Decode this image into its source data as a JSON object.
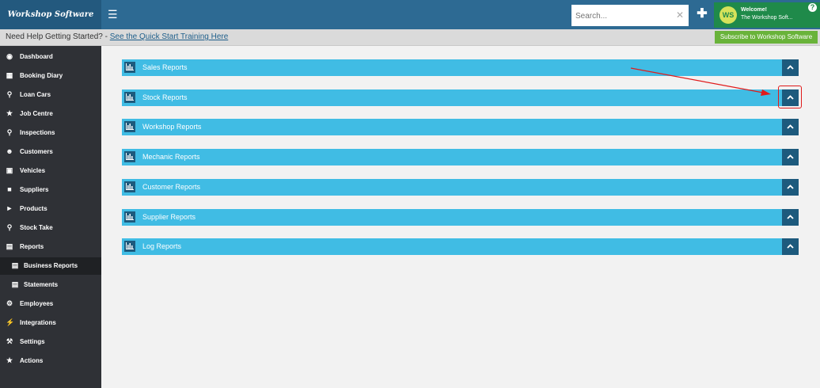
{
  "topbar": {
    "brand": "Workshop Software",
    "search": {
      "placeholder": "Search...",
      "value": ""
    },
    "user": {
      "welcome": "Welcome!",
      "name": "The Workshop Soft..."
    }
  },
  "infobar": {
    "help_prefix": "Need Help Getting Started? - ",
    "help_link": "See the Quick Start Training Here",
    "subscribe_label": "Subscribe to Workshop Software"
  },
  "sidebar": {
    "items": [
      {
        "label": "Dashboard",
        "icon": "dashboard-icon"
      },
      {
        "label": "Booking Diary",
        "icon": "calendar-icon"
      },
      {
        "label": "Loan Cars",
        "icon": "search-icon"
      },
      {
        "label": "Job Centre",
        "icon": "star-icon"
      },
      {
        "label": "Inspections",
        "icon": "search-icon"
      },
      {
        "label": "Customers",
        "icon": "users-icon"
      },
      {
        "label": "Vehicles",
        "icon": "car-icon"
      },
      {
        "label": "Suppliers",
        "icon": "truck-icon"
      },
      {
        "label": "Products",
        "icon": "tag-icon"
      },
      {
        "label": "Stock Take",
        "icon": "search-icon"
      },
      {
        "label": "Reports",
        "icon": "bar-chart-icon"
      },
      {
        "label": "Business Reports",
        "icon": "document-icon",
        "active": true
      },
      {
        "label": "Statements",
        "icon": "document-icon"
      },
      {
        "label": "Employees",
        "icon": "cogs-icon"
      },
      {
        "label": "Integrations",
        "icon": "plug-icon"
      },
      {
        "label": "Settings",
        "icon": "wrench-icon"
      },
      {
        "label": "Actions",
        "icon": "star-icon"
      }
    ]
  },
  "reports": [
    {
      "label": "Sales Reports"
    },
    {
      "label": "Stock Reports",
      "highlighted": true
    },
    {
      "label": "Workshop Reports"
    },
    {
      "label": "Mechanic Reports"
    },
    {
      "label": "Customer Reports"
    },
    {
      "label": "Supplier Reports"
    },
    {
      "label": "Log Reports"
    }
  ],
  "colors": {
    "topbar": "#2d6a93",
    "sidebar": "#2f3136",
    "panel": "#40bce4",
    "panel_dark": "#1d5a7d",
    "subscribe": "#69b33a",
    "annotation": "#e01b1b"
  }
}
